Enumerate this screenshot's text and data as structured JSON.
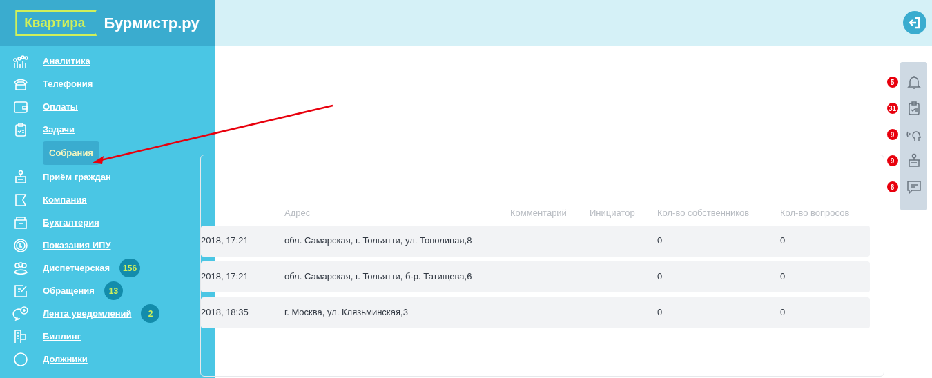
{
  "logo": {
    "brand_box": "Квартира",
    "brand_text": "Бурмистр.ру"
  },
  "sidebar": {
    "items": [
      {
        "label": "Аналитика",
        "selected": false
      },
      {
        "label": "Телефония",
        "selected": false
      },
      {
        "label": "Оплаты",
        "selected": false
      },
      {
        "label": "Задачи",
        "selected": false,
        "children": [
          {
            "label": "Собрания",
            "selected": true
          }
        ]
      },
      {
        "label": "Приём граждан",
        "selected": false
      },
      {
        "label": "Компания",
        "selected": false
      },
      {
        "label": "Бухгалтерия",
        "selected": false
      },
      {
        "label": "Показания ИПУ",
        "selected": false
      },
      {
        "label": "Диспетчерская",
        "selected": false,
        "badge": "156"
      },
      {
        "label": "Обращения",
        "selected": false,
        "badge": "13"
      },
      {
        "label": "Лента уведомлений",
        "selected": false,
        "badge": "2"
      },
      {
        "label": "Биллинг",
        "selected": false
      },
      {
        "label": "Должники",
        "selected": false
      }
    ]
  },
  "table": {
    "columns": [
      "",
      "Адрес",
      "Комментарий",
      "Инициатор",
      "Кол-во собственников",
      "Кол-во вопросов"
    ],
    "rows": [
      [
        "2018, 17:21",
        "обл. Самарская, г. Тольятти, ул. Тополиная,8",
        "",
        "",
        "0",
        "0"
      ],
      [
        "2018, 17:21",
        "обл. Самарская, г. Тольятти, б-р. Татищева,6",
        "",
        "",
        "0",
        "0"
      ],
      [
        "2018, 18:35",
        "г. Москва, ул. Клязьминская,3",
        "",
        "",
        "0",
        "0"
      ]
    ]
  },
  "right_panel": [
    {
      "count": "5"
    },
    {
      "count": "31"
    },
    {
      "count": "9"
    },
    {
      "count": "9"
    },
    {
      "count": "6"
    }
  ]
}
